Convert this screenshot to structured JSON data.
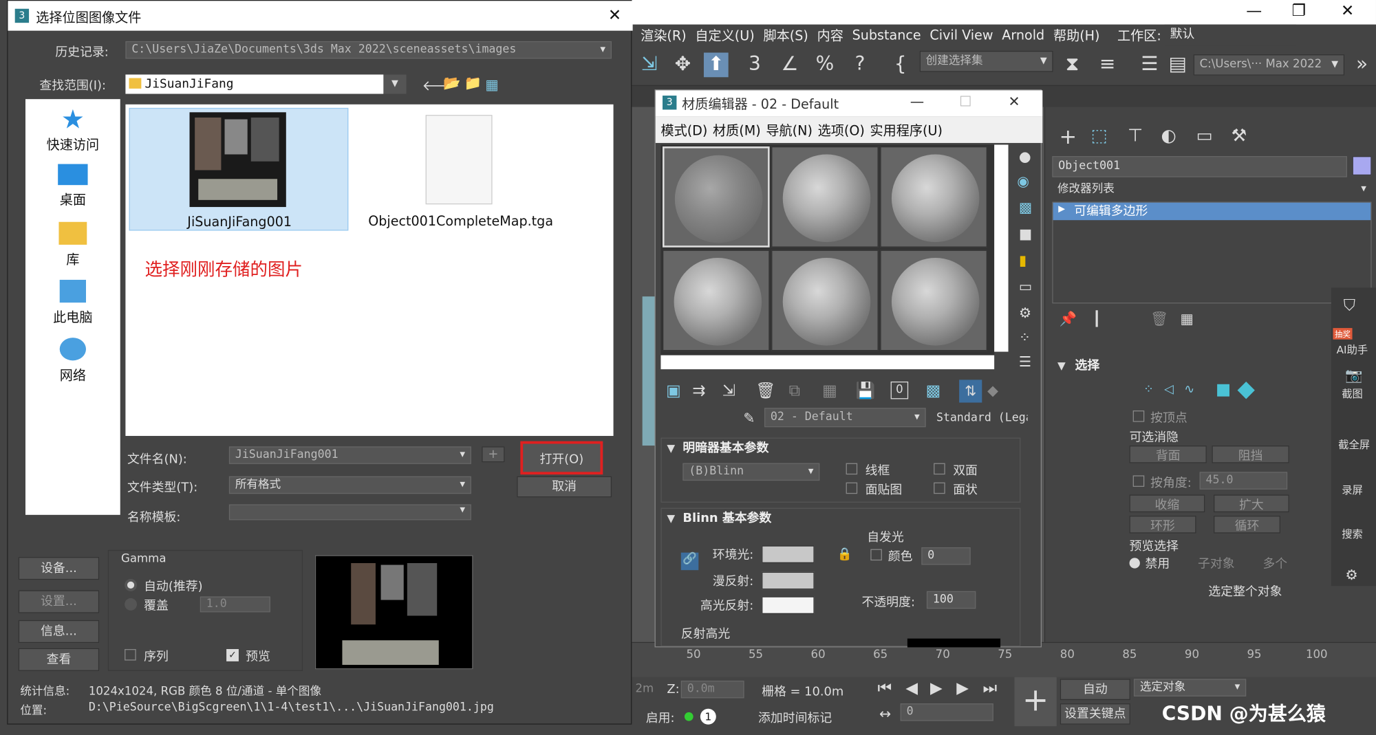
{
  "main_window": {
    "menu": [
      "渲染(R)",
      "自定义(U)",
      "脚本(S)",
      "内容",
      "Substance",
      "Civil View",
      "Arnold",
      "帮助(H)"
    ],
    "workspace_label": "工作区:",
    "workspace_value": "默认",
    "selection_set": "创建选择集",
    "path_combo": "C:\\Users\\··· Max 2022",
    "right_panel": {
      "object_name": "Object001",
      "modifier_list": "修改器列表",
      "modifier_item": "可编辑多边形",
      "select_section": "选择",
      "by_vertex": "按顶点",
      "backface_group": "可选消隐",
      "backface": "背面",
      "occluded": "阻挡",
      "by_angle": "按角度:",
      "angle_value": "45.0",
      "shrink": "收缩",
      "grow": "扩大",
      "ring": "环形",
      "loop": "循环",
      "preview_group": "预览选择",
      "preview_opts": [
        "禁用",
        "子对象",
        "多个"
      ],
      "select_whole": "选定整个对象",
      "side_tools": [
        "AI助手",
        "截图",
        "截全屏",
        "录屏",
        "搜索"
      ],
      "badge": "抽奖"
    },
    "timeline_ticks": [
      "50",
      "55",
      "60",
      "65",
      "70",
      "75",
      "80",
      "85",
      "90",
      "95",
      "100"
    ],
    "bottom": {
      "z_label": "Z:",
      "z_value": "0.0m",
      "x_value": "2m",
      "grid": "栅格 = 10.0m",
      "enable_label": "启用:",
      "enable_count": "1",
      "add_time_tag": "添加时间标记",
      "auto_key": "自动",
      "set_key": "设置关键点",
      "selected_objects": "选定对象",
      "frame": "0",
      "watermark": "CSDN @为甚么猿"
    }
  },
  "dialog": {
    "title": "选择位图图像文件",
    "history_label": "历史记录:",
    "history_value": "C:\\Users\\JiaZe\\Documents\\3ds Max 2022\\sceneassets\\images",
    "lookin_label": "查找范围(I):",
    "lookin_value": "JiSuanJiFang",
    "places": [
      "快速访问",
      "桌面",
      "库",
      "此电脑",
      "网络"
    ],
    "files": [
      {
        "name": "JiSuanJiFang001"
      },
      {
        "name": "Object001CompleteMap.tga"
      }
    ],
    "annotation": "选择刚刚存储的图片",
    "filename_label": "文件名(N):",
    "filename_value": "JiSuanJiFang001",
    "filetype_label": "文件类型(T):",
    "filetype_value": "所有格式",
    "template_label": "名称模板:",
    "open": "打开(O)",
    "cancel": "取消",
    "plus": "+",
    "btns": [
      "设备...",
      "设置...",
      "信息...",
      "查看"
    ],
    "gamma": {
      "title": "Gamma",
      "auto": "自动(推荐)",
      "override": "覆盖",
      "override_value": "1.0"
    },
    "sequence": "序列",
    "preview": "预览",
    "stats_label": "统计信息:",
    "stats_value": "1024x1024, RGB 颜色 8 位/通道 - 单个图像",
    "location_label": "位置:",
    "location_value": "D:\\PieSource\\BigScgreen\\1\\1-4\\test1\\...\\JiSuanJiFang001.jpg"
  },
  "material_editor": {
    "title": "材质编辑器 - 02 - Default",
    "menu": [
      "模式(D)",
      "材质(M)",
      "导航(N)",
      "选项(O)",
      "实用程序(U)"
    ],
    "material_name": "02 - Default",
    "material_type": "Standard (Legac",
    "shader_section": "明暗器基本参数",
    "shader_value": "(B)Blinn",
    "checks": [
      "线框",
      "双面",
      "面贴图",
      "面状"
    ],
    "blinn_section": "Blinn 基本参数",
    "self_illum": "自发光",
    "color": "颜色",
    "color_value": "0",
    "ambient": "环境光:",
    "diffuse": "漫反射:",
    "specular": "高光反射:",
    "opacity": "不透明度:",
    "opacity_value": "100",
    "spec_hl": "反射高光"
  }
}
